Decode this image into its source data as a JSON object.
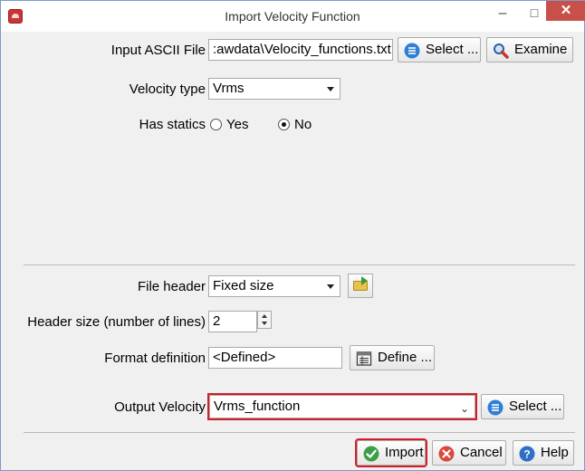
{
  "window": {
    "title": "Import Velocity Function",
    "minimize": "–",
    "maximize": "□",
    "close": "✕"
  },
  "input_file": {
    "label": "Input ASCII File",
    "value": ":awdata\\Velocity_functions.txt",
    "select_label": "Select ...",
    "examine_label": "Examine"
  },
  "velocity_type": {
    "label": "Velocity type",
    "value": "Vrms"
  },
  "has_statics": {
    "label": "Has statics",
    "options": [
      "Yes",
      "No"
    ],
    "selected": "No"
  },
  "file_header": {
    "label": "File header",
    "value": "Fixed size"
  },
  "header_size": {
    "label": "Header size (number of lines)",
    "value": "2"
  },
  "format_definition": {
    "label": "Format definition",
    "value": "<Defined>",
    "define_label": "Define ..."
  },
  "output_velocity": {
    "label": "Output Velocity",
    "value": "Vrms_function",
    "select_label": "Select ..."
  },
  "footer": {
    "import_label": "Import",
    "cancel_label": "Cancel",
    "help_label": "Help"
  },
  "colors": {
    "highlight_outline": "#d21f2a",
    "close_button": "#c7504a",
    "select_icon": "#2f7fd6",
    "import_icon": "#3aa047",
    "cancel_icon": "#d9473d",
    "help_icon": "#2f6fc6"
  },
  "icons": {
    "app": "app-icon",
    "select": "list-icon",
    "examine": "magnifier-icon",
    "folder": "folder-open-icon",
    "define": "table-icon",
    "import": "check-icon",
    "cancel": "x-circle-icon",
    "help": "question-icon"
  }
}
